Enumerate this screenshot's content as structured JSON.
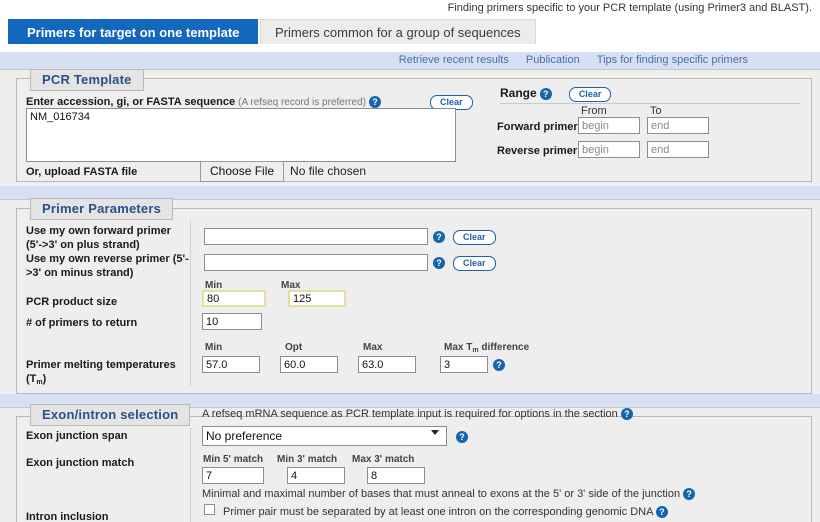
{
  "header": {
    "strapline": "Finding primers specific to your PCR template (using Primer3 and BLAST)."
  },
  "tabs": [
    {
      "label": "Primers for target on one template",
      "active": true
    },
    {
      "label": "Primers common for a group of sequences",
      "active": false
    }
  ],
  "toplinks": [
    {
      "label": "Retrieve recent results"
    },
    {
      "label": "Publication"
    },
    {
      "label": "Tips for finding specific primers"
    }
  ],
  "pcr_template": {
    "legend": "PCR Template",
    "sequence_label": "Enter accession, gi, or FASTA sequence",
    "sequence_hint": "(A refseq record is preferred)",
    "sequence_value": "NM_016734",
    "sequence_clear": "Clear",
    "upload_label": "Or, upload FASTA file",
    "file_button": "Choose File",
    "file_status": "No file chosen",
    "range": {
      "title": "Range",
      "clear": "Clear",
      "col_from": "From",
      "col_to": "To",
      "rows": [
        {
          "label": "Forward primer",
          "from_placeholder": "begin",
          "to_placeholder": "end"
        },
        {
          "label": "Reverse primer",
          "from_placeholder": "begin",
          "to_placeholder": "end"
        }
      ]
    }
  },
  "primer_parameters": {
    "legend": "Primer Parameters",
    "own_forward_label": "Use my own forward primer (5'->3' on plus strand)",
    "own_forward_value": "",
    "own_forward_clear": "Clear",
    "own_reverse_label": "Use my own reverse primer (5'->3' on minus strand)",
    "own_reverse_value": "",
    "own_reverse_clear": "Clear",
    "product_size_label": "PCR product size",
    "product_size_min_header": "Min",
    "product_size_max_header": "Max",
    "product_size_min": "80",
    "product_size_max": "125",
    "num_primers_label": "# of primers to return",
    "num_primers_value": "10",
    "tm_label_line1": "Primer melting temperatures",
    "tm_label_line2_pre": "(T",
    "tm_label_line2_sub": "m",
    "tm_label_line2_post": ")",
    "tm_min_header": "Min",
    "tm_opt_header": "Opt",
    "tm_max_header": "Max",
    "tm_min": "57.0",
    "tm_opt": "60.0",
    "tm_max": "63.0",
    "tm_diff_header_pre": "Max T",
    "tm_diff_header_sub": "m",
    "tm_diff_header_post": " difference",
    "tm_diff_value": "3"
  },
  "exon_intron": {
    "legend": "Exon/intron selection",
    "note": "A refseq mRNA sequence as PCR template input is required for options in the section",
    "junction_span_label": "Exon junction span",
    "junction_span_value": "No preference",
    "junction_span_options": [
      "No preference"
    ],
    "junction_match_label": "Exon junction match",
    "min5_header": "Min 5' match",
    "min3_header": "Min 3' match",
    "max3_header": "Max 3' match",
    "min5_value": "7",
    "min3_value": "4",
    "max3_value": "8",
    "junction_match_note": "Minimal and maximal number of bases that must anneal to exons at the 5' or 3' side of the junction",
    "intron_inclusion_label": "Intron inclusion",
    "intron_inclusion_text": "Primer pair must be separated by at least one intron on the corresponding genomic DNA",
    "intron_inclusion_checked": false
  },
  "icons": {
    "help": "?",
    "help_icon_name": "help-icon"
  },
  "colors": {
    "accent_blue": "#1368bd",
    "band_blue": "#d7e0f2",
    "body_grey": "#eeeeee",
    "legend_text": "#2b4f8a",
    "link_blue": "#4a6ea8",
    "highlight_yellow": "#e4e09a"
  }
}
